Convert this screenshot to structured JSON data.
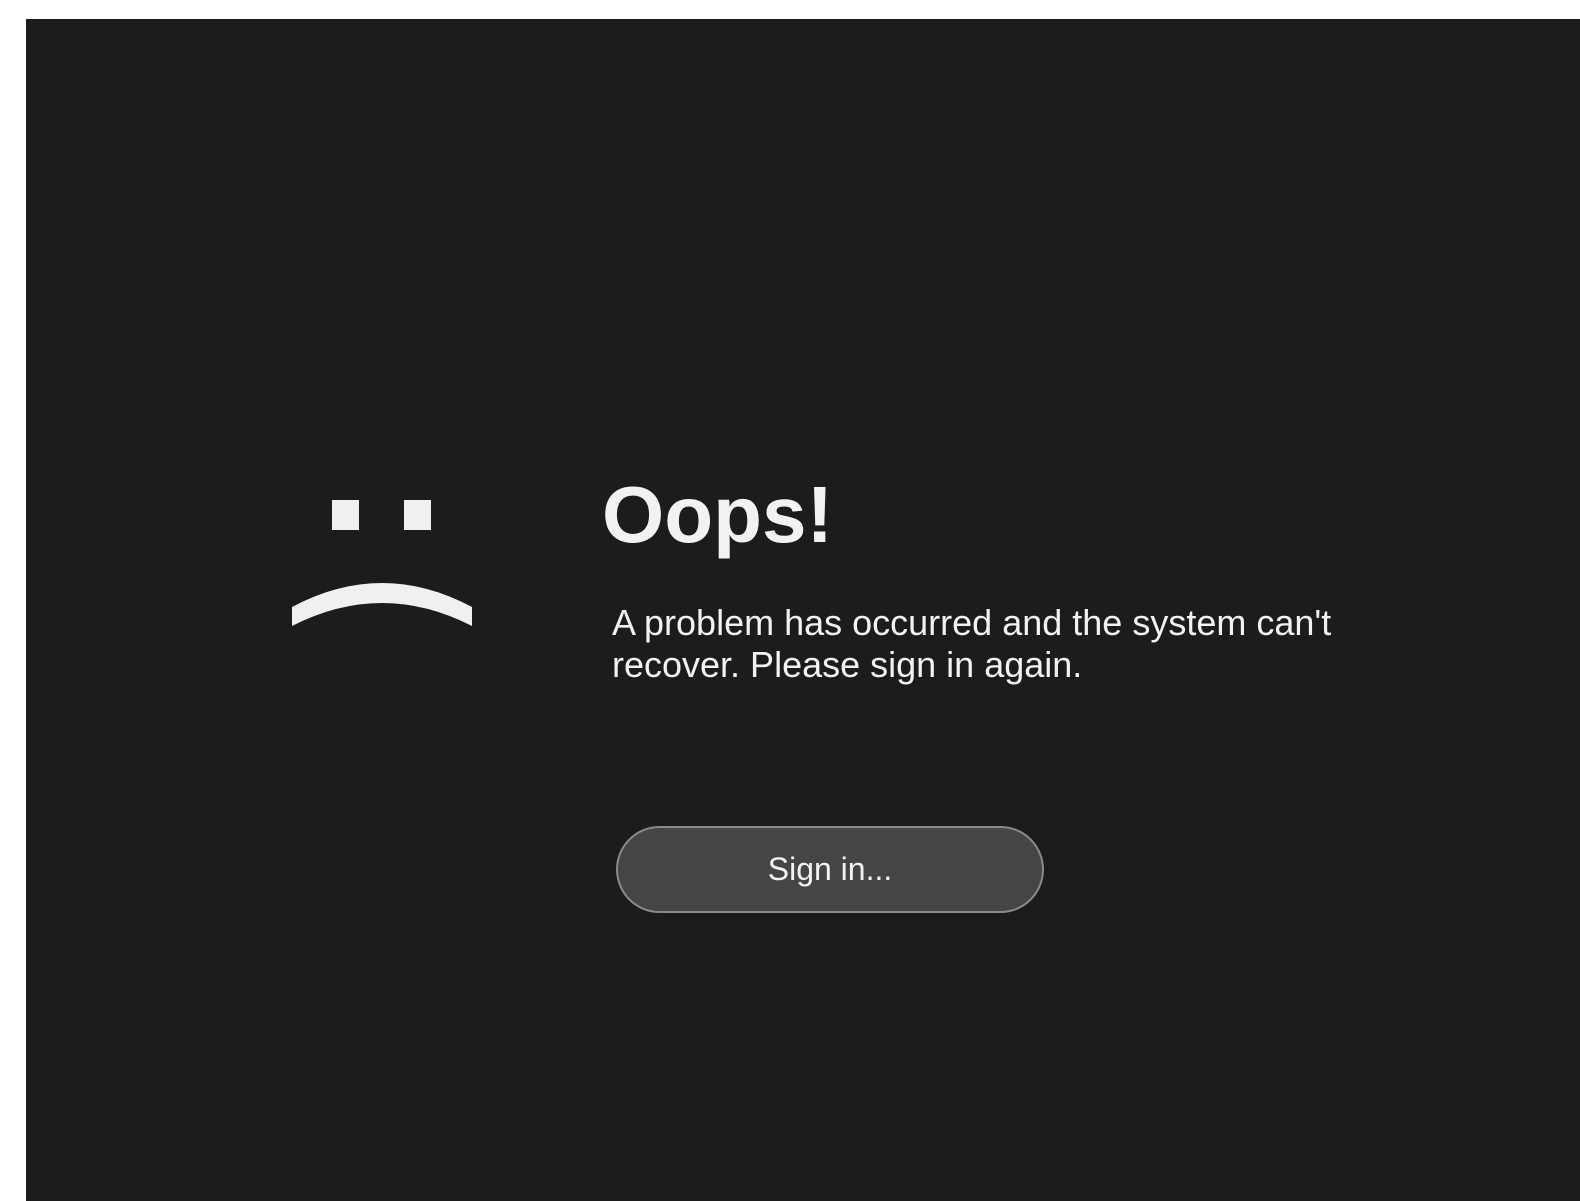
{
  "error": {
    "icon": "sad-face-icon",
    "title": "Oops!",
    "message": "A problem has occurred and the system can't\nrecover.  Please sign in again.",
    "sign_in_label": "Sign in..."
  },
  "colors": {
    "background": "#1c1c1c",
    "text": "#f2f2f2",
    "button_fill": "#454545",
    "button_border": "#8a8a8a"
  }
}
